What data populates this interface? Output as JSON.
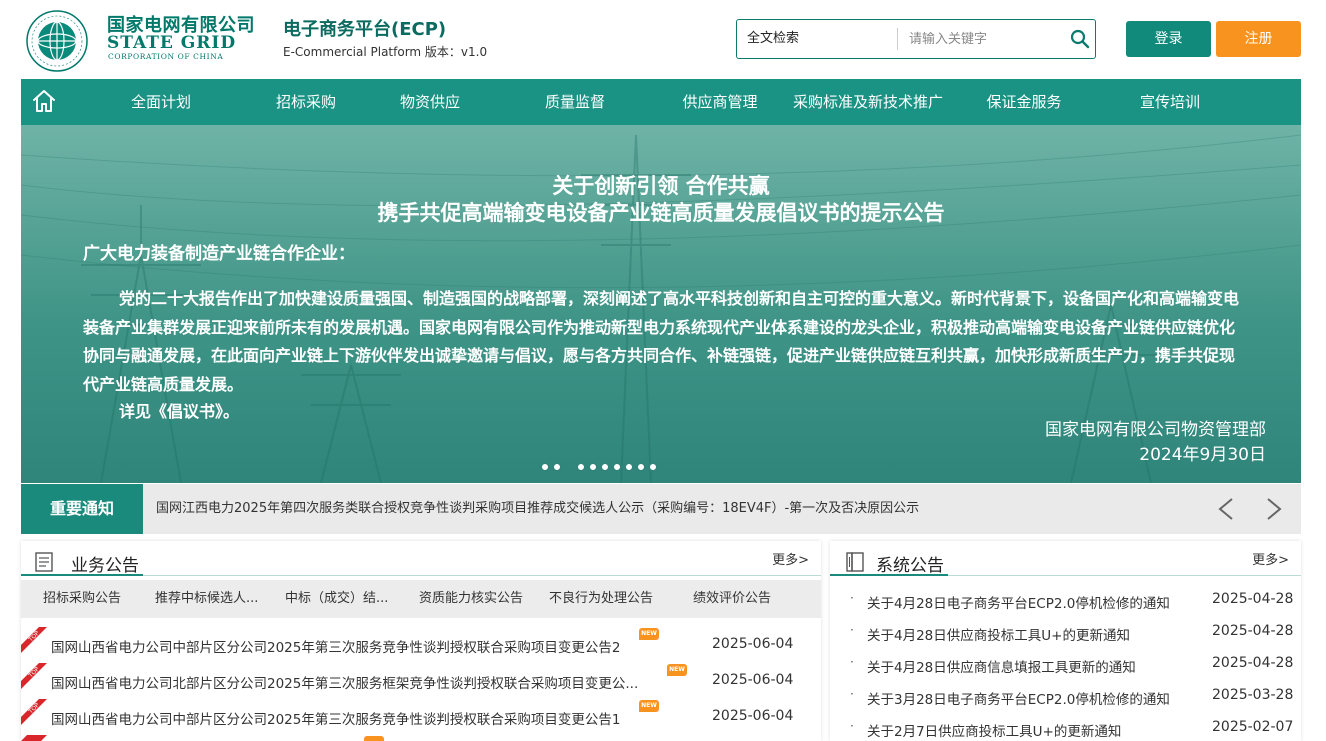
{
  "header": {
    "logo_cn": "国家电网有限公司",
    "logo_en1": "STATE GRID",
    "logo_en2": "CORPORATION OF CHINA",
    "platform_title": "电子商务平台(ECP)",
    "platform_subtitle": "E-Commercial Platform 版本：v1.0",
    "search": {
      "type_label": "全文检索",
      "placeholder": "请输入关键字",
      "value": ""
    },
    "login_label": "登录",
    "register_label": "注册"
  },
  "nav": {
    "items": [
      {
        "label": "全面计划"
      },
      {
        "label": "招标采购"
      },
      {
        "label": "物资供应"
      },
      {
        "label": "质量监督"
      },
      {
        "label": "供应商管理"
      },
      {
        "label": "采购标准及新技术推广"
      },
      {
        "label": "保证金服务"
      },
      {
        "label": "宣传培训"
      }
    ]
  },
  "banner": {
    "title_line1": "关于创新引领 合作共赢",
    "title_line2": "携手共促高端输变电设备产业链高质量发展倡议书的提示公告",
    "greeting": "广大电力装备制造产业链合作企业：",
    "body": "党的二十大报告作出了加快建设质量强国、制造强国的战略部署，深刻阐述了高水平科技创新和自主可控的重大意义。新时代背景下，设备国产化和高端输变电装备产业集群发展正迎来前所未有的发展机遇。国家电网有限公司作为推动新型电力系统现代产业体系建设的龙头企业，积极推动高端输变电设备产业链供应链优化协同与融通发展，在此面向产业链上下游伙伴发出诚挚邀请与倡议，愿与各方共同合作、补链强链，促进产业链供应链互利共赢，加快形成新质生产力，携手共促现代产业链高质量发展。",
    "detail": "详见《倡议书》。",
    "org": "国家电网有限公司物资管理部",
    "date": "2024年9月30日"
  },
  "notice": {
    "label": "重要通知",
    "text": "国网江西电力2025年第四次服务类联合授权竞争性谈判采购项目推荐成交候选人公示（采购编号：18EV4F）-第一次及否决原因公示",
    "prev_glyph": "<",
    "next_glyph": ">"
  },
  "business": {
    "title": "业务公告",
    "more": "更多>",
    "tabs": [
      {
        "label": "招标采购公告"
      },
      {
        "label": "推荐中标候选人..."
      },
      {
        "label": "中标（成交）结..."
      },
      {
        "label": "资质能力核实公告"
      },
      {
        "label": "不良行为处理公告"
      },
      {
        "label": "绩效评价公告"
      }
    ],
    "rows": [
      {
        "top": "TOP",
        "title": "国网山西省电力公司中部片区分公司2025年第三次服务竞争性谈判授权联合采购项目变更公告2",
        "badge": "NEW",
        "date": "2025-06-04"
      },
      {
        "top": "TOP",
        "title": "国网山西省电力公司北部片区分公司2025年第三次服务框架竞争性谈判授权联合采购项目变更公...",
        "badge": "NEW",
        "date": "2025-06-04"
      },
      {
        "top": "TOP",
        "title": "国网山西省电力公司中部片区分公司2025年第三次服务竞争性谈判授权联合采购项目变更公告1",
        "badge": "NEW",
        "date": "2025-06-04"
      }
    ]
  },
  "system": {
    "title": "系统公告",
    "more": "更多>",
    "bullet": "·",
    "rows": [
      {
        "title": "关于4月28日电子商务平台ECP2.0停机检修的通知",
        "date": "2025-04-28"
      },
      {
        "title": "关于4月28日供应商投标工具U+的更新通知",
        "date": "2025-04-28"
      },
      {
        "title": "关于4月28日供应商信息填报工具更新的通知",
        "date": "2025-04-28"
      },
      {
        "title": "关于3月28日电子商务平台ECP2.0停机检修的通知",
        "date": "2025-03-28"
      },
      {
        "title": "关于2月7日供应商投标工具U+的更新通知",
        "date": "2025-02-07"
      }
    ]
  },
  "colors": {
    "brand_green": "#1a9384",
    "dark_green": "#1a8a7c",
    "orange": "#f7931e",
    "top_red": "#d9262b"
  }
}
